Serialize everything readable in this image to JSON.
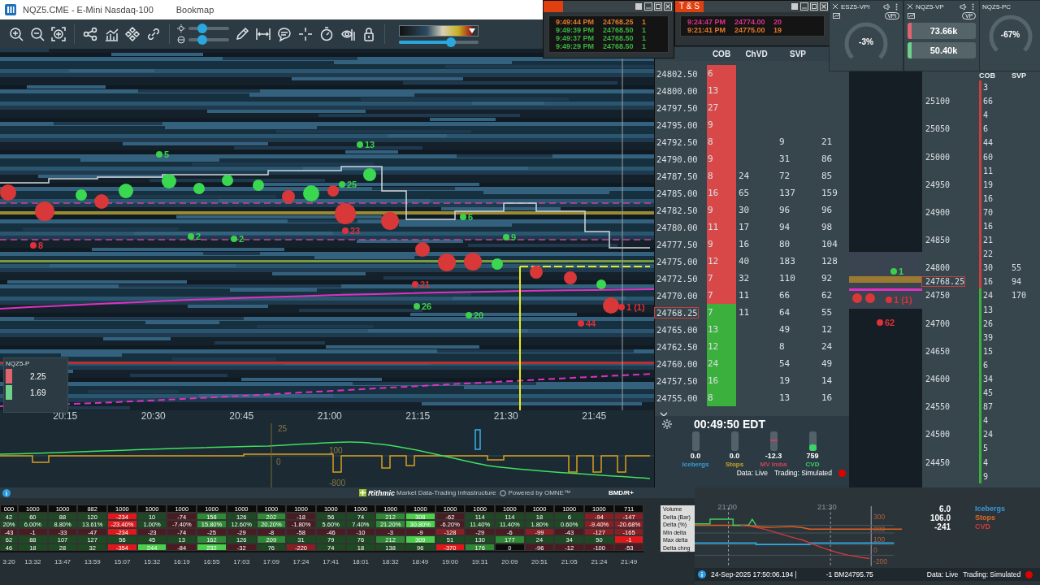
{
  "window": {
    "title": "NQZ5.CME - E-Mini Nasdaq-100",
    "app": "Bookmap"
  },
  "toolbar": {
    "sliders": [
      {
        "level": 0.33
      },
      {
        "level": 0.33
      }
    ],
    "color_scale": {
      "level": 0.65
    }
  },
  "time_sales": [
    {
      "rows": [
        {
          "time": "9:49:44 PM",
          "price": "24768.25",
          "size": "1",
          "color": "#e07a2a"
        },
        {
          "time": "9:49:39 PM",
          "price": "24768.50",
          "size": "1",
          "color": "#3cb043"
        },
        {
          "time": "9:49:37 PM",
          "price": "24768.50",
          "size": "1",
          "color": "#3cb043"
        },
        {
          "time": "9:49:29 PM",
          "price": "24768.50",
          "size": "1",
          "color": "#3cb043"
        }
      ]
    },
    {
      "title": "T & S",
      "rows": [
        {
          "time": "9:24:47 PM",
          "price": "24774.00",
          "size": "20",
          "color": "#e0308a"
        },
        {
          "time": "9:21:41 PM",
          "price": "24775.00",
          "size": "19",
          "color": "#e07a2a"
        }
      ]
    }
  ],
  "gauges": [
    {
      "title": "ESZ5-VPI",
      "badge": "VPI",
      "kind": "dial",
      "closable": true,
      "value": "-3%"
    },
    {
      "title": "NQZ5-VP",
      "badge": "VP",
      "kind": "bars",
      "closable": true,
      "bars": [
        {
          "value": "73.66k",
          "color": "#e06470"
        },
        {
          "value": "50.40k",
          "color": "#6fd08a"
        }
      ]
    },
    {
      "title": "NQZ5-PC",
      "kind": "dial",
      "closable": false,
      "value": "-67%"
    }
  ],
  "heatmap": {
    "markers": [
      {
        "label": "5",
        "color": "#3cd04a"
      },
      {
        "label": "13",
        "color": "#3cd04a"
      },
      {
        "label": "25",
        "color": "#3cd04a"
      },
      {
        "label": "2",
        "color": "#3cd04a"
      },
      {
        "label": "2",
        "color": "#3cd04a"
      },
      {
        "label": "6",
        "color": "#3cd04a"
      },
      {
        "label": "9",
        "color": "#3cd04a"
      },
      {
        "label": "26",
        "color": "#3cd04a"
      },
      {
        "label": "20",
        "color": "#3cd04a"
      },
      {
        "label": "8",
        "color": "#e0303a"
      },
      {
        "label": "23",
        "color": "#e0303a"
      },
      {
        "label": "21",
        "color": "#e0303a"
      },
      {
        "label": "44",
        "color": "#e0303a"
      },
      {
        "label": "1 (1)",
        "color": "#e0303a"
      }
    ],
    "widget": {
      "title": "NQZ5-P",
      "values": [
        {
          "value": "2.25",
          "color": "#e06470"
        },
        {
          "value": "1.69",
          "color": "#6fd08a"
        }
      ]
    },
    "time_axis": [
      "20:15",
      "20:30",
      "20:45",
      "21:00",
      "21:15",
      "21:30",
      "21:45"
    ],
    "oscillator_labels": [
      "25",
      "100",
      "0",
      "-800"
    ]
  },
  "ladder": {
    "columns": [
      "COB",
      "ChVD",
      "SVP"
    ],
    "rows": [
      {
        "price": "24802.50",
        "cob": "6",
        "color": "#d84848",
        "current": false
      },
      {
        "price": "24800.00",
        "cob": "13",
        "color": "#d84848",
        "current": false
      },
      {
        "price": "24797.50",
        "cob": "27",
        "color": "#d84848",
        "current": false
      },
      {
        "price": "24795.00",
        "cob": "9",
        "color": "#d84848",
        "current": false
      },
      {
        "price": "24792.50",
        "cob": "8",
        "color": "#d84848",
        "current": false,
        "svp_sell": "9",
        "svp_buy": "21"
      },
      {
        "price": "24790.00",
        "cob": "9",
        "color": "#d84848",
        "current": false,
        "svp_sell": "31",
        "svp_buy": "86"
      },
      {
        "price": "24787.50",
        "cob": "8",
        "color": "#d84848",
        "current": false,
        "chvd": "24",
        "svp_sell": "72",
        "svp_buy": "85"
      },
      {
        "price": "24785.00",
        "cob": "16",
        "color": "#d84848",
        "current": false,
        "chvd": "65",
        "svp_sell": "137",
        "svp_buy": "159"
      },
      {
        "price": "24782.50",
        "cob": "9",
        "color": "#d84848",
        "current": false,
        "chvd": "30",
        "svp_sell": "96",
        "svp_buy": "96"
      },
      {
        "price": "24780.00",
        "cob": "11",
        "color": "#d84848",
        "current": false,
        "chvd": "17",
        "svp_sell": "94",
        "svp_buy": "98"
      },
      {
        "price": "24777.50",
        "cob": "9",
        "color": "#d84848",
        "current": false,
        "chvd": "16",
        "svp_sell": "80",
        "svp_buy": "104"
      },
      {
        "price": "24775.00",
        "cob": "12",
        "color": "#d84848",
        "current": false,
        "chvd": "40",
        "svp_sell": "183",
        "svp_buy": "128"
      },
      {
        "price": "24772.50",
        "cob": "7",
        "color": "#d84848",
        "current": false,
        "chvd": "32",
        "svp_sell": "110",
        "svp_buy": "92"
      },
      {
        "price": "24770.00",
        "cob": "7",
        "color": "#d84848",
        "current": false,
        "chvd": "11",
        "svp_sell": "66",
        "svp_buy": "62"
      },
      {
        "price": "24768.25",
        "cob": "7",
        "color": "#3cb03c",
        "current": true,
        "chvd": "11",
        "svp_sell": "64",
        "svp_buy": "55"
      },
      {
        "price": "24765.00",
        "cob": "13",
        "color": "#3cb03c",
        "current": false,
        "svp_sell": "49",
        "svp_buy": "12"
      },
      {
        "price": "24762.50",
        "cob": "12",
        "color": "#3cb03c",
        "current": false,
        "svp_sell": "8",
        "svp_buy": "24"
      },
      {
        "price": "24760.00",
        "cob": "24",
        "color": "#3cb03c",
        "current": false,
        "svp_sell": "54",
        "svp_buy": "49"
      },
      {
        "price": "24757.50",
        "cob": "16",
        "color": "#3cb03c",
        "current": false,
        "svp_sell": "19",
        "svp_buy": "14"
      },
      {
        "price": "24755.00",
        "cob": "8",
        "color": "#3cb03c",
        "current": false,
        "svp_sell": "13",
        "svp_buy": "16"
      }
    ]
  },
  "indicators": {
    "clock": "00:49:50 EDT",
    "meters": [
      {
        "value": "0.0",
        "label": "Icebergs",
        "color": "#3a9ad9",
        "kind": "fill"
      },
      {
        "value": "0.0",
        "label": "Stops",
        "color": "#c9a227",
        "kind": "fill"
      },
      {
        "value": "-12.3",
        "label": "MV Imba",
        "color": "#d0405a",
        "kind": "tick",
        "level": 0.6
      },
      {
        "value": "759",
        "label": "CVD",
        "color": "#3cd46a",
        "kind": "fill",
        "level": 0.35
      }
    ],
    "data_status": "Data: Live",
    "trading_status": "Trading: Simulated"
  },
  "right_panel": {
    "markers": [
      {
        "label": "1",
        "color": "#3cd04a"
      },
      {
        "label": "62",
        "color": "#e0303a"
      },
      {
        "label": "1 (1)",
        "color": "#e0303a"
      }
    ],
    "columns": [
      "COB",
      "SVP"
    ],
    "rows": [
      {
        "cob": "3",
        "color": "#c84040"
      },
      {
        "price": "25100",
        "cob": "66",
        "color": "#c84040",
        "current": false
      },
      {
        "cob": "4",
        "color": "#c84040"
      },
      {
        "price": "25050",
        "cob": "6",
        "color": "#c84040",
        "current": false
      },
      {
        "cob": "44",
        "color": "#c84040"
      },
      {
        "price": "25000",
        "cob": "60",
        "color": "#c84040",
        "current": false
      },
      {
        "cob": "11",
        "color": "#c84040"
      },
      {
        "price": "24950",
        "cob": "19",
        "color": "#c84040",
        "current": false
      },
      {
        "cob": "16",
        "color": "#c84040"
      },
      {
        "price": "24900",
        "cob": "70",
        "color": "#c84040",
        "current": false
      },
      {
        "cob": "16",
        "color": "#c84040"
      },
      {
        "price": "24850",
        "cob": "21",
        "color": "#c84040",
        "current": false
      },
      {
        "cob": "22",
        "color": "#c84040"
      },
      {
        "price": "24800",
        "cob": "30",
        "color": "#c84040",
        "current": false,
        "svp": "55"
      },
      {
        "price": "24768.25",
        "cob": "16",
        "color": "#c84040",
        "current": true,
        "svp": "94"
      },
      {
        "price": "24750",
        "cob": "24",
        "color": "#3cb03c",
        "current": false,
        "svp": "170"
      },
      {
        "cob": "13",
        "color": "#3cb03c"
      },
      {
        "price": "24700",
        "cob": "26",
        "color": "#3cb03c",
        "current": false
      },
      {
        "cob": "39",
        "color": "#3cb03c"
      },
      {
        "price": "24650",
        "cob": "15",
        "color": "#3cb03c",
        "current": false
      },
      {
        "cob": "6",
        "color": "#3cb03c"
      },
      {
        "price": "24600",
        "cob": "34",
        "color": "#3cb03c",
        "current": false
      },
      {
        "cob": "45",
        "color": "#3cb03c"
      },
      {
        "price": "24550",
        "cob": "87",
        "color": "#3cb03c",
        "current": false
      },
      {
        "cob": "4",
        "color": "#3cb03c"
      },
      {
        "price": "24500",
        "cob": "24",
        "color": "#3cb03c",
        "current": false
      },
      {
        "cob": "5",
        "color": "#3cb03c"
      },
      {
        "price": "24450",
        "cob": "4",
        "color": "#3cb03c",
        "current": false
      },
      {
        "cob": "9",
        "color": "#3cb03c"
      }
    ]
  },
  "info_bar": {
    "provider": "Rithmic",
    "tagline": "Market Data-Trading Infrastructure",
    "powered": "Powered by OMNE™",
    "connection": "BMD/R+"
  },
  "table": {
    "row_labels": [
      "Volume",
      "Delta (Bar)",
      "Delta (%)",
      "Min delta",
      "Max delta",
      "Delta chng"
    ],
    "columns": [
      {
        "time": "3:20",
        "cells": [
          {
            "v": "000",
            "color": "#0b0b0b"
          },
          {
            "v": "42",
            "color": "#1d4a22"
          },
          {
            "v": "20%",
            "color": "#1d4a22"
          },
          {
            "v": "-43",
            "color": "#4a1c22"
          },
          {
            "v": "62",
            "color": "#1d4a22"
          },
          {
            "v": "46",
            "color": "#1d4a22"
          }
        ]
      },
      {
        "time": "13:32",
        "cells": [
          {
            "v": "1000",
            "color": "#0b0b0b"
          },
          {
            "v": "60",
            "color": "#1d4a22"
          },
          {
            "v": "6.00%",
            "color": "#1d4a22"
          },
          {
            "v": "-1",
            "color": "#4a1c22"
          },
          {
            "v": "88",
            "color": "#1d4a22"
          },
          {
            "v": "18",
            "color": "#1d4a22"
          }
        ]
      },
      {
        "time": "13:47",
        "cells": [
          {
            "v": "1000",
            "color": "#0b0b0b"
          },
          {
            "v": "88",
            "color": "#1d4a22"
          },
          {
            "v": "8.80%",
            "color": "#1d4a22"
          },
          {
            "v": "-33",
            "color": "#4a1c22"
          },
          {
            "v": "107",
            "color": "#1d4a22"
          },
          {
            "v": "28",
            "color": "#1d4a22"
          }
        ]
      },
      {
        "time": "13:59",
        "cells": [
          {
            "v": "882",
            "color": "#0b0b0b"
          },
          {
            "v": "120",
            "color": "#1d4a22"
          },
          {
            "v": "13.61%",
            "color": "#1d4a22"
          },
          {
            "v": "-47",
            "color": "#4a1c22"
          },
          {
            "v": "127",
            "color": "#1d4a22"
          },
          {
            "v": "32",
            "color": "#1d4a22"
          }
        ]
      },
      {
        "time": "15:07",
        "cells": [
          {
            "v": "1000",
            "color": "#0b0b0b"
          },
          {
            "v": "-234",
            "color": "#e0181c"
          },
          {
            "v": "-23.40%",
            "color": "#e0181c"
          },
          {
            "v": "-234",
            "color": "#e0181c"
          },
          {
            "v": "56",
            "color": "#1d4a22"
          },
          {
            "v": "-354",
            "color": "#e0181c"
          }
        ]
      },
      {
        "time": "15:32",
        "cells": [
          {
            "v": "1000",
            "color": "#0b0b0b"
          },
          {
            "v": "10",
            "color": "#1d4a22"
          },
          {
            "v": "1.00%",
            "color": "#1d4a22"
          },
          {
            "v": "-23",
            "color": "#4a1c22"
          },
          {
            "v": "45",
            "color": "#1d4a22"
          },
          {
            "v": "244",
            "color": "#4cd04c"
          }
        ]
      },
      {
        "time": "16:19",
        "cells": [
          {
            "v": "1000",
            "color": "#0b0b0b"
          },
          {
            "v": "-74",
            "color": "#4a1c22"
          },
          {
            "v": "-7.40%",
            "color": "#4a1c22"
          },
          {
            "v": "-74",
            "color": "#4a1c22"
          },
          {
            "v": "13",
            "color": "#1d4a22"
          },
          {
            "v": "-84",
            "color": "#4a1c22"
          }
        ]
      },
      {
        "time": "16:55",
        "cells": [
          {
            "v": "1000",
            "color": "#0b0b0b"
          },
          {
            "v": "158",
            "color": "#2e8a34"
          },
          {
            "v": "15.80%",
            "color": "#2e8a34"
          },
          {
            "v": "-25",
            "color": "#4a1c22"
          },
          {
            "v": "162",
            "color": "#2e8a34"
          },
          {
            "v": "232",
            "color": "#4cd04c"
          }
        ]
      },
      {
        "time": "17:03",
        "cells": [
          {
            "v": "1000",
            "color": "#0b0b0b"
          },
          {
            "v": "126",
            "color": "#1d4a22"
          },
          {
            "v": "12.60%",
            "color": "#1d4a22"
          },
          {
            "v": "-29",
            "color": "#4a1c22"
          },
          {
            "v": "126",
            "color": "#1d4a22"
          },
          {
            "v": "-32",
            "color": "#4a1c22"
          }
        ]
      },
      {
        "time": "17:09",
        "cells": [
          {
            "v": "1000",
            "color": "#0b0b0b"
          },
          {
            "v": "202",
            "color": "#2e8a34"
          },
          {
            "v": "20.20%",
            "color": "#2e8a34"
          },
          {
            "v": "-8",
            "color": "#4a1c22"
          },
          {
            "v": "209",
            "color": "#2e8a34"
          },
          {
            "v": "76",
            "color": "#1d4a22"
          }
        ]
      },
      {
        "time": "17:24",
        "cells": [
          {
            "v": "1000",
            "color": "#0b0b0b"
          },
          {
            "v": "-18",
            "color": "#4a1c22"
          },
          {
            "v": "-1.80%",
            "color": "#4a1c22"
          },
          {
            "v": "-58",
            "color": "#4a1c22"
          },
          {
            "v": "31",
            "color": "#1d4a22"
          },
          {
            "v": "-220",
            "color": "#8a1e24"
          }
        ]
      },
      {
        "time": "17:41",
        "cells": [
          {
            "v": "1000",
            "color": "#0b0b0b"
          },
          {
            "v": "56",
            "color": "#1d4a22"
          },
          {
            "v": "5.60%",
            "color": "#1d4a22"
          },
          {
            "v": "-46",
            "color": "#4a1c22"
          },
          {
            "v": "79",
            "color": "#1d4a22"
          },
          {
            "v": "74",
            "color": "#1d4a22"
          }
        ]
      },
      {
        "time": "18:01",
        "cells": [
          {
            "v": "1000",
            "color": "#0b0b0b"
          },
          {
            "v": "74",
            "color": "#1d4a22"
          },
          {
            "v": "7.40%",
            "color": "#1d4a22"
          },
          {
            "v": "-10",
            "color": "#4a1c22"
          },
          {
            "v": "76",
            "color": "#1d4a22"
          },
          {
            "v": "18",
            "color": "#1d4a22"
          }
        ]
      },
      {
        "time": "18:32",
        "cells": [
          {
            "v": "1000",
            "color": "#0b0b0b"
          },
          {
            "v": "212",
            "color": "#2e8a34"
          },
          {
            "v": "21.20%",
            "color": "#2e8a34"
          },
          {
            "v": "-3",
            "color": "#4a1c22"
          },
          {
            "v": "212",
            "color": "#2e8a34"
          },
          {
            "v": "138",
            "color": "#1d4a22"
          }
        ]
      },
      {
        "time": "18:49",
        "cells": [
          {
            "v": "1000",
            "color": "#0b0b0b"
          },
          {
            "v": "308",
            "color": "#4cd04c"
          },
          {
            "v": "30.80%",
            "color": "#4cd04c"
          },
          {
            "v": "-9",
            "color": "#4a1c22"
          },
          {
            "v": "309",
            "color": "#4cd04c"
          },
          {
            "v": "96",
            "color": "#1d4a22"
          }
        ]
      },
      {
        "time": "19:00",
        "cells": [
          {
            "v": "1000",
            "color": "#0b0b0b"
          },
          {
            "v": "-62",
            "color": "#4a1c22"
          },
          {
            "v": "-6.20%",
            "color": "#4a1c22"
          },
          {
            "v": "-128",
            "color": "#8a1e24"
          },
          {
            "v": "51",
            "color": "#1d4a22"
          },
          {
            "v": "-370",
            "color": "#e0181c"
          }
        ]
      },
      {
        "time": "19:31",
        "cells": [
          {
            "v": "1000",
            "color": "#0b0b0b"
          },
          {
            "v": "114",
            "color": "#1d4a22"
          },
          {
            "v": "11.40%",
            "color": "#1d4a22"
          },
          {
            "v": "-29",
            "color": "#4a1c22"
          },
          {
            "v": "130",
            "color": "#1d4a22"
          },
          {
            "v": "176",
            "color": "#2e8a34"
          }
        ]
      },
      {
        "time": "20:09",
        "cells": [
          {
            "v": "1000",
            "color": "#0b0b0b"
          },
          {
            "v": "114",
            "color": "#1d4a22"
          },
          {
            "v": "11.40%",
            "color": "#1d4a22"
          },
          {
            "v": "-6",
            "color": "#4a1c22"
          },
          {
            "v": "177",
            "color": "#2e8a34"
          },
          {
            "v": "0",
            "color": "#0b0b0b"
          }
        ]
      },
      {
        "time": "20:51",
        "cells": [
          {
            "v": "1000",
            "color": "#0b0b0b"
          },
          {
            "v": "18",
            "color": "#1d4a22"
          },
          {
            "v": "1.80%",
            "color": "#1d4a22"
          },
          {
            "v": "-99",
            "color": "#8a1e24"
          },
          {
            "v": "24",
            "color": "#1d4a22"
          },
          {
            "v": "-96",
            "color": "#4a1c22"
          }
        ]
      },
      {
        "time": "21:05",
        "cells": [
          {
            "v": "1000",
            "color": "#0b0b0b"
          },
          {
            "v": "6",
            "color": "#1d4a22"
          },
          {
            "v": "0.60%",
            "color": "#1d4a22"
          },
          {
            "v": "-43",
            "color": "#4a1c22"
          },
          {
            "v": "34",
            "color": "#1d4a22"
          },
          {
            "v": "-12",
            "color": "#4a1c22"
          }
        ]
      },
      {
        "time": "21:24",
        "cells": [
          {
            "v": "1000",
            "color": "#0b0b0b"
          },
          {
            "v": "-94",
            "color": "#8a1e24"
          },
          {
            "v": "-9.40%",
            "color": "#8a1e24"
          },
          {
            "v": "-127",
            "color": "#8a1e24"
          },
          {
            "v": "50",
            "color": "#1d4a22"
          },
          {
            "v": "-100",
            "color": "#4a1c22"
          }
        ]
      },
      {
        "time": "21:49",
        "cells": [
          {
            "v": "711",
            "color": "#0b0b0b"
          },
          {
            "v": "-147",
            "color": "#8a1e24"
          },
          {
            "v": "-20.68%",
            "color": "#8a1e24"
          },
          {
            "v": "-165",
            "color": "#8a1e24"
          },
          {
            "v": "-1",
            "color": "#e0181c"
          },
          {
            "v": "-53",
            "color": "#4a1c22"
          }
        ]
      }
    ]
  },
  "mini_chart": {
    "time_labels": [
      "21:00",
      "21:30"
    ],
    "scale_labels": [
      "300",
      "000",
      "100",
      "0",
      "-200"
    ]
  },
  "stats": [
    {
      "value": "6.0",
      "label": "Icebergs",
      "color": "#3a9ad9"
    },
    {
      "value": "106.0",
      "label": "Stops",
      "color": "#e06a2a"
    },
    {
      "value": "-241",
      "label": "CVD",
      "color": "#d03a3a"
    }
  ],
  "status_bar": {
    "timestamp": "24-Sep-2025 17:50:06.194 |",
    "position": "-1 BM24795.75",
    "data_status": "Data: Live",
    "trading_status": "Trading: Simulated"
  }
}
